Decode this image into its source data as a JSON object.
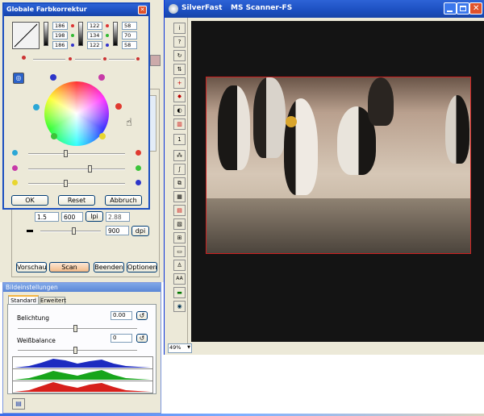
{
  "main_window": {
    "title": "SilverFast",
    "subtitle": "MS Scanner-FS",
    "zoom": "49%",
    "toolbar_row_label": "1"
  },
  "color_dialog": {
    "title": "Globale Farbkorrektur",
    "close_glyph": "✕",
    "values": {
      "col1": [
        "186",
        "198",
        "186"
      ],
      "col2": [
        "122",
        "134",
        "122"
      ],
      "col3": [
        "58",
        "70",
        "58"
      ]
    },
    "buttons": {
      "ok": "OK",
      "reset": "Reset",
      "cancel": "Abbruch"
    },
    "sliders": [
      {
        "left": "cyan",
        "right": "red",
        "value": 0.5
      },
      {
        "left": "magenta",
        "right": "green",
        "value": 0.6
      },
      {
        "left": "yellow",
        "right": "blue",
        "value": 0.5
      }
    ]
  },
  "scan_panel": {
    "value_a": "1.5",
    "value_b": "600",
    "unit_lpi": "lpi",
    "value_c": "2.88",
    "dpi_value": "900",
    "unit_dpi": "dpi",
    "buttons": {
      "preview": "Vorschau",
      "scan": "Scan",
      "quit": "Beenden",
      "options": "Optionen"
    }
  },
  "image_settings": {
    "title": "Bildeinstellungen",
    "tabs": [
      "Standard",
      "Erweitert"
    ],
    "exposure_label": "Belichtung",
    "exposure_value": "0.00",
    "white_balance_label": "Weißbalance",
    "white_balance_value": "0",
    "exposure_slider": 0.5,
    "white_balance_slider": 0.5
  },
  "colors": {
    "xp_blue": "#1c4fc0",
    "dialog_bg": "#ece9d8",
    "preview_bg": "#141414",
    "frame_red": "#cc2020"
  }
}
